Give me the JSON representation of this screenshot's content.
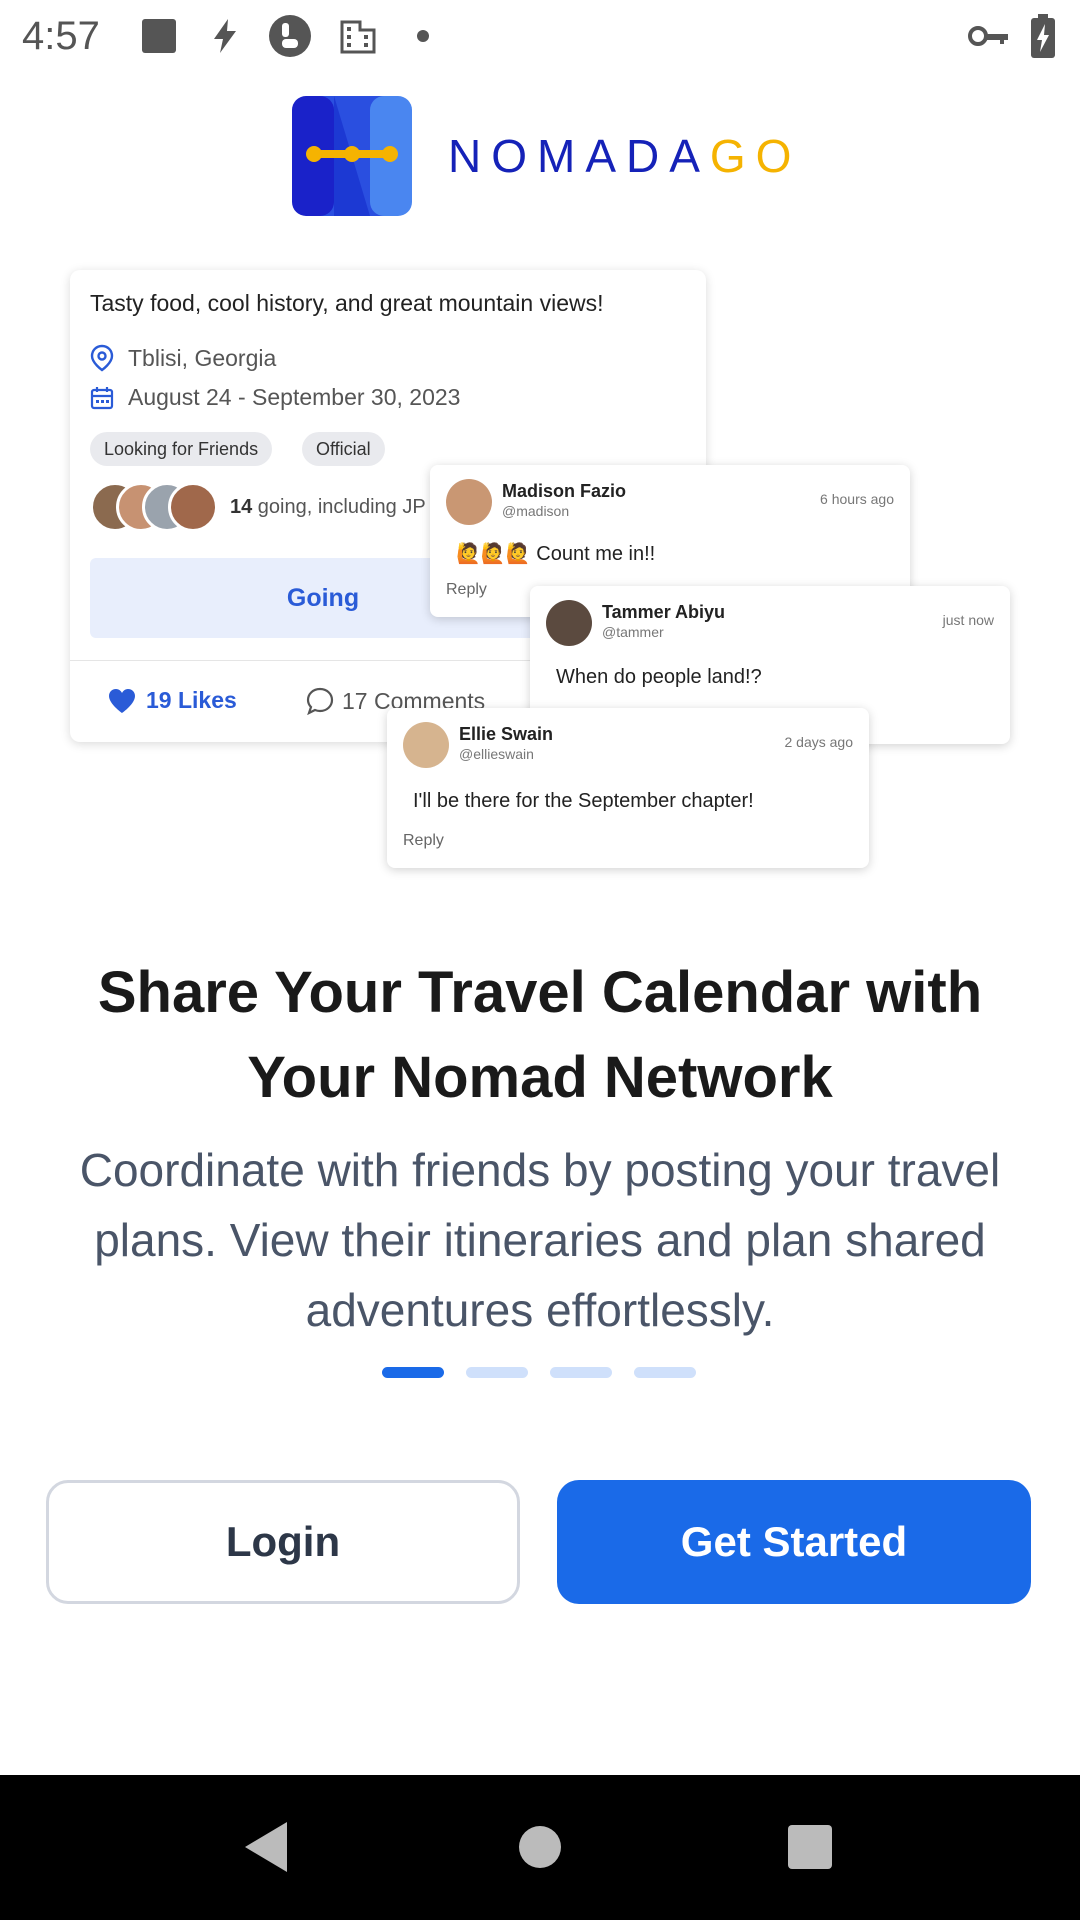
{
  "status_bar": {
    "time": "4:57"
  },
  "logo": {
    "name_main": "NOMADA",
    "name_accent": "GO"
  },
  "event_card": {
    "description": "Tasty food, cool history, and great mountain views!",
    "location": "Tblisi, Georgia",
    "dates": "August 24 - September 30, 2023",
    "tags": [
      "Looking for Friends",
      "Official"
    ],
    "going_count": "14",
    "going_text": " going, including JP",
    "going_button": "Going",
    "likes": "19 Likes",
    "comments": "17 Comments"
  },
  "comments": [
    {
      "name": "Madison Fazio",
      "handle": "@madison",
      "time": "6 hours ago",
      "body": "🙋🙋🙋 Count me in!!",
      "reply": "Reply"
    },
    {
      "name": "Tammer Abiyu",
      "handle": "@tammer",
      "time": "just now",
      "body": "When do people land!?",
      "reply": ""
    },
    {
      "name": "Ellie Swain",
      "handle": "@ellieswain",
      "time": "2 days ago",
      "body": "I'll be there for the September chapter!",
      "reply": "Reply"
    }
  ],
  "onboarding": {
    "headline": "Share Your Travel Calendar with Your Nomad Network",
    "subtext": "Coordinate with friends by posting your travel plans. View their itineraries and plan shared adventures effortlessly.",
    "pager": {
      "total": 4,
      "active": 1
    }
  },
  "buttons": {
    "login": "Login",
    "get_started": "Get Started"
  },
  "colors": {
    "primary": "#1a6ae8",
    "logo_blue": "#1522b8",
    "logo_gold": "#f5b301"
  }
}
